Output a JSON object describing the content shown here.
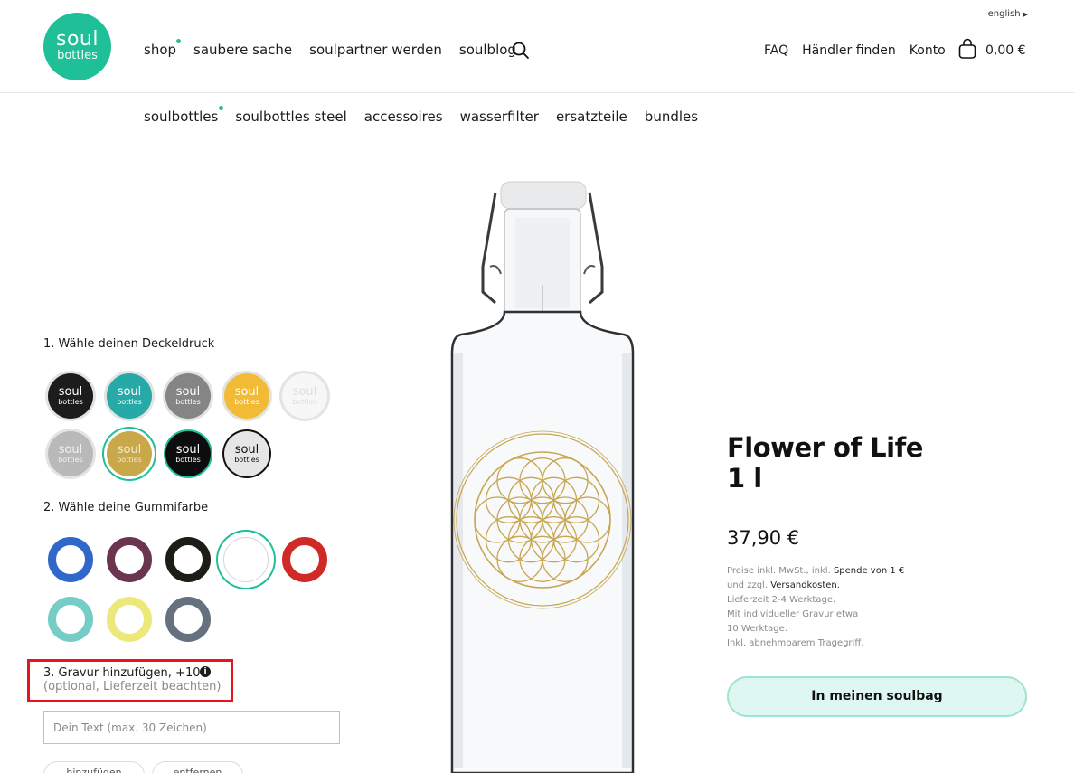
{
  "brand": {
    "line1": "soul",
    "line2": "bottles",
    "color": "#1fbf97"
  },
  "language": {
    "label": "english"
  },
  "main_nav": [
    {
      "label": "shop",
      "active": true
    },
    {
      "label": "saubere sache"
    },
    {
      "label": "soulpartner werden"
    },
    {
      "label": "soulblog"
    }
  ],
  "right_nav": [
    {
      "label": "FAQ"
    },
    {
      "label": "Händler finden"
    },
    {
      "label": "Konto"
    }
  ],
  "cart": {
    "amount": "0,00 €"
  },
  "sub_nav": [
    {
      "label": "soulbottles",
      "active": true
    },
    {
      "label": "soulbottles steel"
    },
    {
      "label": "accessoires"
    },
    {
      "label": "wasserfilter"
    },
    {
      "label": "ersatzteile"
    },
    {
      "label": "bundles"
    }
  ],
  "configurator": {
    "cap_label": "1. Wähle deinen Deckeldruck",
    "caps": [
      {
        "line1": "soul",
        "line2": "bottles",
        "color": "#1c1c1c",
        "text": "#ffffff"
      },
      {
        "line1": "soul",
        "line2": "bottles",
        "color": "#27a9a8",
        "text": "#ffffff"
      },
      {
        "line1": "soul",
        "line2": "bottles",
        "color": "#858585",
        "text": "#ffffff"
      },
      {
        "line1": "soul",
        "line2": "bottles",
        "color": "#f2bb35",
        "text": "#ffffff"
      },
      {
        "line1": "soul",
        "line2": "bottles",
        "color": "#f7f7f7",
        "text": "#dddddd"
      },
      {
        "line1": "soul",
        "line2": "bottles",
        "color": "#b9b9b9",
        "text": "#f2f2f2"
      },
      {
        "line1": "soul",
        "line2": "bottles",
        "color": "#c9a84a",
        "text": "#f4ead0",
        "selected": true
      },
      {
        "line1": "soul",
        "line2": "bottles",
        "color": "#0d0d0d",
        "text": "#ffffff",
        "border": "#1fbf97"
      },
      {
        "line1": "soul",
        "line2": "bottles",
        "color": "#e6e6e6",
        "text": "#111111",
        "border": "#111111"
      }
    ],
    "gum_label": "2. Wähle deine Gummifarbe",
    "gums": [
      {
        "color": "#2f68c9"
      },
      {
        "color": "#6b3550"
      },
      {
        "color": "#1d1d17"
      },
      {
        "color": "#eeeeee",
        "selected": true
      },
      {
        "color": "#d02a27"
      },
      {
        "color": "#76ccc6"
      },
      {
        "color": "#ece97a"
      },
      {
        "color": "#667180"
      }
    ],
    "engrave_title": "3. Gravur hinzufügen, +10€",
    "engrave_sub": "(optional, Lieferzeit beachten)",
    "engrave_placeholder": "Dein Text (max. 30 Zeichen)",
    "pill_1": "hinzufügen",
    "pill_2": "entfernen"
  },
  "product": {
    "title_line1": "Flower of Life",
    "title_line2": "1 l",
    "price": "37,90 €",
    "legal_1": "Preise inkl. MwSt., inkl.",
    "legal_1_link": "Spende von 1 €",
    "legal_2": "und zzgl.",
    "legal_2_link": "Versandkosten.",
    "legal_3": "Lieferzeit 2-4 Werktage.",
    "legal_4": "Mit individueller Gravur etwa",
    "legal_5": "10 Werktage.",
    "legal_6": "Inkl. abnehmbarem Tragegriff.",
    "cta": "In meinen soulbag"
  }
}
